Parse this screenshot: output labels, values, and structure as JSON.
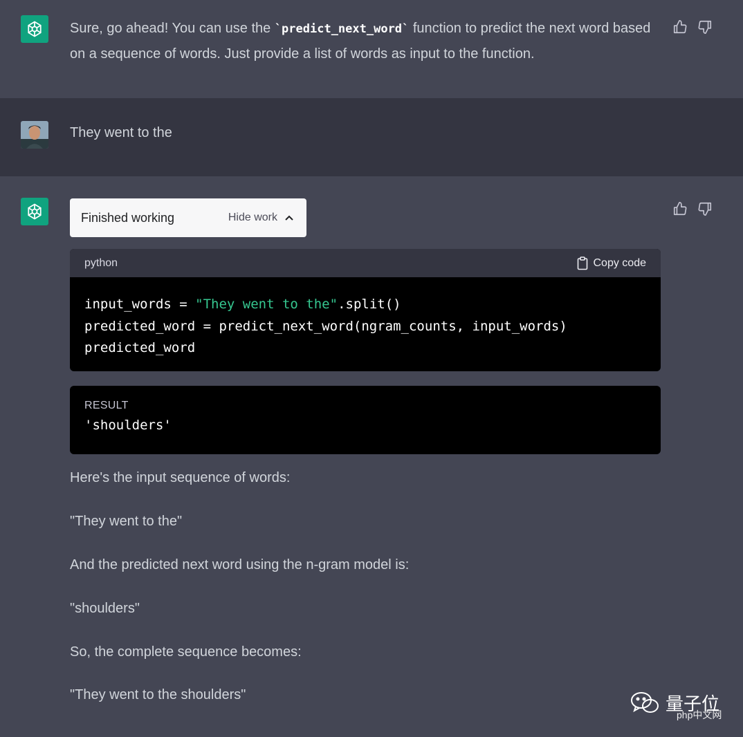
{
  "messages": {
    "first": {
      "text_pre": "Sure, go ahead! You can use the ",
      "code": "`predict_next_word`",
      "text_post": " function to predict the next word based on a sequence of words. Just provide a list of words as input to the function."
    },
    "user": {
      "text": "They went to the"
    },
    "second": {
      "work_title": "Finished working",
      "hide_label": "Hide work",
      "code_lang": "python",
      "copy_label": "Copy code",
      "code_lines": {
        "l1_a": "input_words = ",
        "l1_str": "\"They went to the\"",
        "l1_b": ".split()",
        "l2": "predicted_word = predict_next_word(ngram_counts, input_words)",
        "l3": "predicted_word"
      },
      "result_label": "RESULT",
      "result_value": "'shoulders'",
      "paragraphs": [
        "Here's the input sequence of words:",
        "\"They went to the\"",
        "And the predicted next word using the n-gram model is:",
        "\"shoulders\"",
        "So, the complete sequence becomes:",
        "\"They went to the shoulders\""
      ]
    }
  },
  "watermark": {
    "text": "量子位",
    "sub": "php中文网"
  },
  "colors": {
    "assistant_bg": "#444654",
    "user_bg": "#343541",
    "gpt_green": "#10a37f",
    "string_green": "#36c790"
  }
}
